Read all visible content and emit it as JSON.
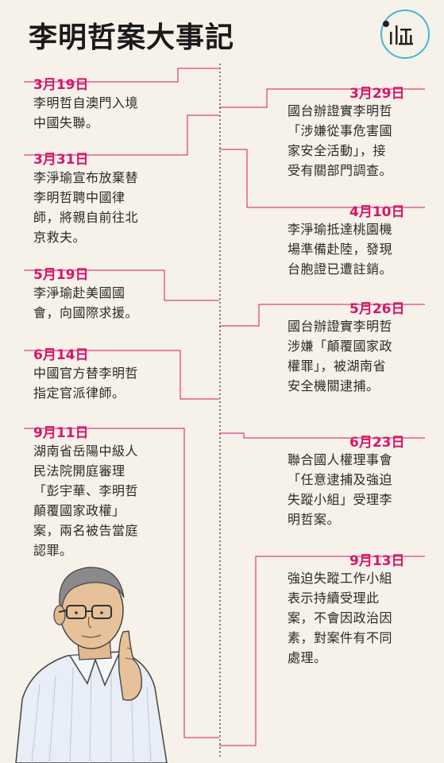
{
  "title": "李明哲案大事記",
  "colors": {
    "accent": "#d4176b",
    "background": "#f6f1e9",
    "logo_ring": "#43b7d3"
  },
  "left_events": [
    {
      "date": "3月19日",
      "lines": [
        "李明哲自澳門入境",
        "中國失聯。"
      ]
    },
    {
      "date": "3月31日",
      "lines": [
        "李淨瑜宣布放棄替",
        "李明哲聘中國律",
        "師，將親自前往北",
        "京救夫。"
      ]
    },
    {
      "date": "5月19日",
      "lines": [
        "李淨瑜赴美國國",
        "會，向國際求援。"
      ]
    },
    {
      "date": "6月14日",
      "lines": [
        "中國官方替李明哲",
        "指定官派律師。"
      ]
    },
    {
      "date": "9月11日",
      "lines": [
        "湖南省岳陽中級人",
        "民法院開庭審理",
        "「彭宇華、李明哲",
        "顛覆國家政權」",
        "案，兩名被告當庭",
        "認罪。"
      ]
    }
  ],
  "right_events": [
    {
      "date": "3月29日",
      "lines": [
        "國台辦證實李明哲",
        "「涉嫌從事危害國",
        "家安全活動」，接",
        "受有關部門調查。"
      ]
    },
    {
      "date": "4月10日",
      "lines": [
        "李淨瑜抵達桃園機",
        "場準備赴陸，發現",
        "台胞證已遭註銷。"
      ]
    },
    {
      "date": "5月26日",
      "lines": [
        "國台辦證實李明哲",
        "涉嫌「顛覆國家政",
        "權罪」，被湖南省",
        "安全機關逮捕。"
      ]
    },
    {
      "date": "6月23日",
      "lines": [
        "聯合國人權理事會",
        "「任意逮捕及強迫",
        "失蹤小組」受理李",
        "明哲案。"
      ]
    },
    {
      "date": "9月13日",
      "lines": [
        "強迫失蹤工作小組",
        "表示持續受理此",
        "案，不會因政治因",
        "素，對案件有不同",
        "處理。"
      ]
    }
  ]
}
